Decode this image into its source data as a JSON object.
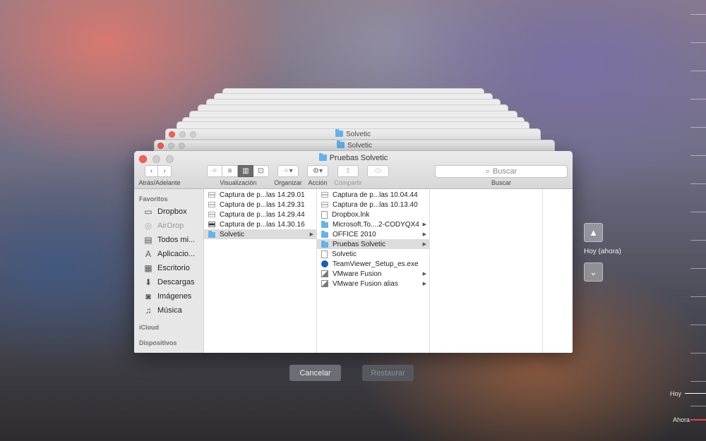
{
  "background_stack": {
    "back_window_titles": [
      "Solvetic",
      "Solvetic"
    ]
  },
  "window": {
    "title": "Pruebas Solvetic",
    "toolbar": {
      "nav_label": "Atrás/Adelante",
      "view_label": "Visualización",
      "arrange_label": "Organizar",
      "action_label": "Acción",
      "share_label": "Compartir",
      "search_placeholder": "Buscar",
      "search_label": "Buscar"
    },
    "sidebar": {
      "favorites_heading": "Favoritos",
      "items": [
        {
          "label": "Dropbox",
          "icon": "folder-icon"
        },
        {
          "label": "AirDrop",
          "icon": "airdrop-icon"
        },
        {
          "label": "Todos mi...",
          "icon": "all-files-icon"
        },
        {
          "label": "Aplicacio...",
          "icon": "applications-icon"
        },
        {
          "label": "Escritorio",
          "icon": "desktop-icon"
        },
        {
          "label": "Descargas",
          "icon": "downloads-icon"
        },
        {
          "label": "Imágenes",
          "icon": "pictures-icon"
        },
        {
          "label": "Música",
          "icon": "music-icon"
        }
      ],
      "icloud_heading": "iCloud",
      "devices_heading": "Dispositivos"
    },
    "columns": [
      {
        "items": [
          {
            "label": "Captura de p...las 14.29.01",
            "type": "image-file"
          },
          {
            "label": "Captura de p...las 14.29.31",
            "type": "image-file"
          },
          {
            "label": "Captura de p...las 14.29.44",
            "type": "image-file"
          },
          {
            "label": "Captura de p...las 14.30.16",
            "type": "image-file-dark"
          },
          {
            "label": "Solvetic",
            "type": "folder",
            "selected": true,
            "has_children": true
          }
        ]
      },
      {
        "items": [
          {
            "label": "Captura de p...las 10.04.44",
            "type": "image-file"
          },
          {
            "label": "Captura de p...las 10.13.40",
            "type": "image-file"
          },
          {
            "label": "Dropbox.lnk",
            "type": "file"
          },
          {
            "label": "Microsoft.To....2-CODYQX4",
            "type": "folder",
            "has_children": true
          },
          {
            "label": "OFFICE 2010",
            "type": "folder",
            "has_children": true
          },
          {
            "label": "Pruebas Solvetic",
            "type": "folder",
            "selected": true,
            "has_children": true
          },
          {
            "label": "Solvetic",
            "type": "file"
          },
          {
            "label": "TeamViewer_Setup_es.exe",
            "type": "teamviewer"
          },
          {
            "label": "VMware Fusion",
            "type": "vmware",
            "has_children": true
          },
          {
            "label": "VMware Fusion alias",
            "type": "vmware",
            "has_children": true
          }
        ]
      },
      {
        "items": []
      },
      {
        "items": []
      }
    ]
  },
  "buttons": {
    "cancel": "Cancelar",
    "restore": "Restaurar"
  },
  "time_machine": {
    "current_label": "Hoy (ahora)",
    "timeline_label": "Hoy",
    "timeline_bottom_label": "Ahora"
  },
  "colors": {
    "close_red": "#fc5f57",
    "folder_blue": "#62b3ea",
    "selected_row": "#dcdcdc"
  }
}
